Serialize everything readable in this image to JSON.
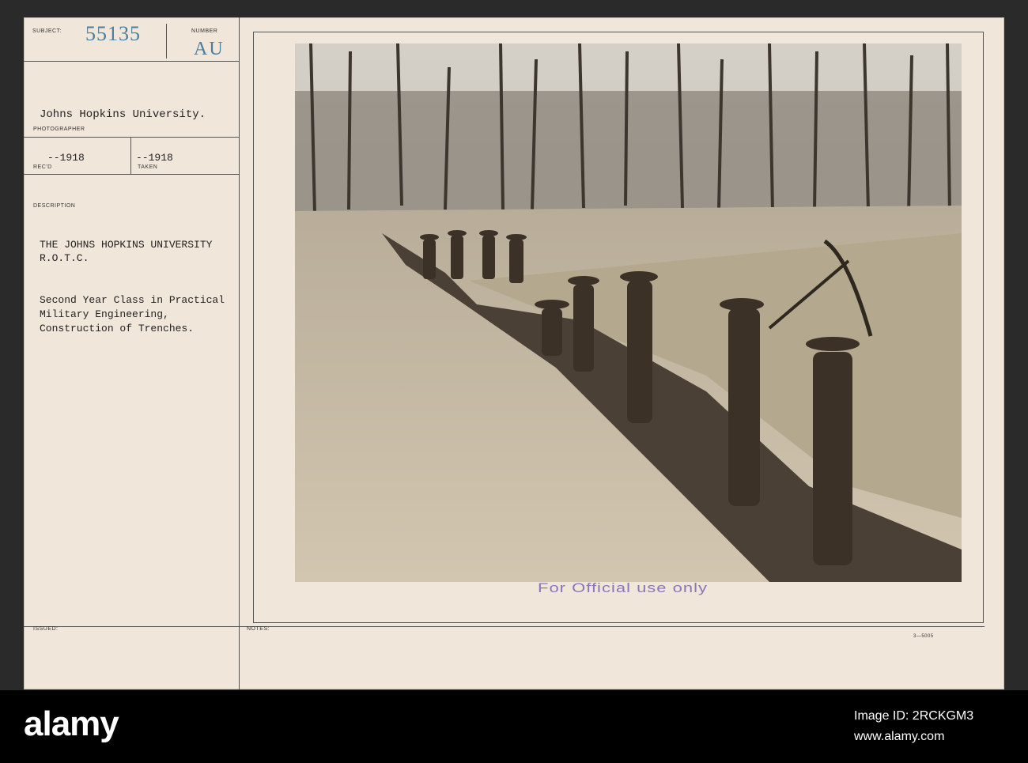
{
  "card": {
    "subject_label": "SUBJECT:",
    "subject_number": "55135",
    "number_label": "NUMBER",
    "number_value": "AU",
    "photographer_value": "Johns Hopkins University.",
    "photographer_label": "PHOTOGRAPHER",
    "recd_value": "--1918",
    "recd_label": "REC'D",
    "taken_value": "--1918",
    "taken_label": "TAKEN",
    "description_label": "DESCRIPTION",
    "description_title_1": "THE JOHNS HOPKINS UNIVERSITY",
    "description_title_2": "R.O.T.C.",
    "description_body_1": "Second Year Class in Practical",
    "description_body_2": "Military Engineering,",
    "description_body_3": "Construction of Trenches.",
    "issued_label": "ISSUED:",
    "notes_label": "NOTES:",
    "official_stamp": "For Official use only",
    "form_number": "3—5005"
  },
  "watermark": {
    "brand": "alamy",
    "image_id": "Image ID: 2RCKGM3",
    "site": "www.alamy.com"
  }
}
